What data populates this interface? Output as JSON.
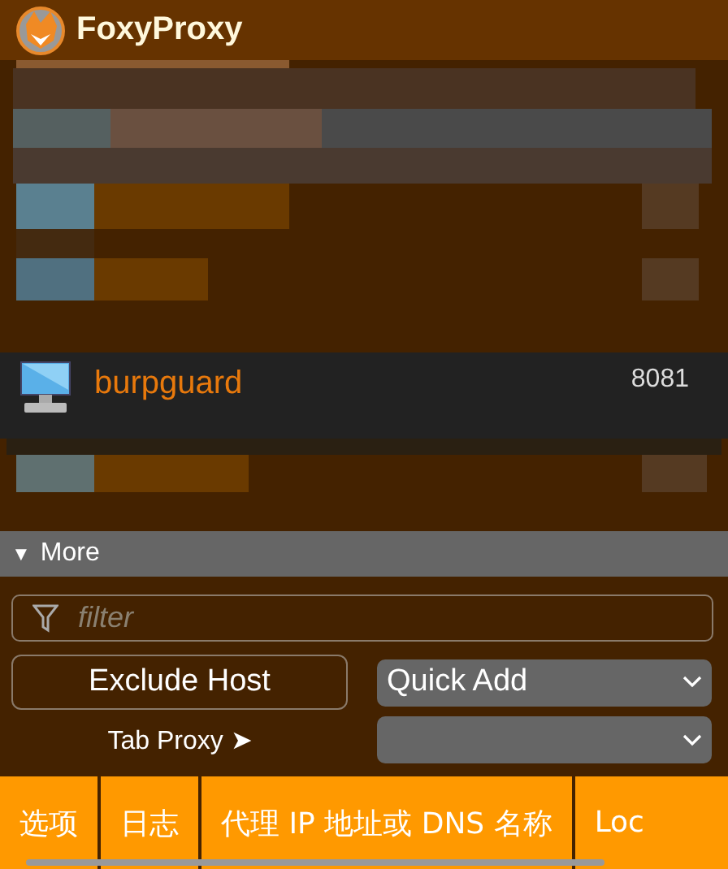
{
  "header": {
    "title": "FoxyProxy"
  },
  "proxies": [
    {
      "kind": "blurred"
    },
    {
      "kind": "proxy",
      "name": "burpguard",
      "port": "8081"
    },
    {
      "kind": "blurred"
    }
  ],
  "more": {
    "icon": "▼",
    "label": "More"
  },
  "filter": {
    "placeholder": "filter"
  },
  "exclude_button": "Exclude Host",
  "quick_add": {
    "value": "Quick Add"
  },
  "tab_proxy": {
    "label": "Tab Proxy ➤"
  },
  "footer_tabs": [
    {
      "label": "选项"
    },
    {
      "label": "日志"
    },
    {
      "label": "代理 IP 地址或 DNS 名称"
    },
    {
      "label": "Loc"
    }
  ]
}
